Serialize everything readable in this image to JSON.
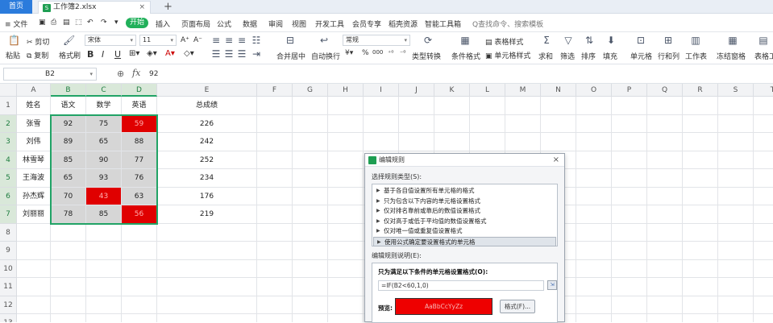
{
  "tabs": {
    "home": "首页",
    "file": "工作簿2.xlsx",
    "file_icon": "S",
    "close": "×",
    "add": "+"
  },
  "menu": {
    "file": "≡ 文件",
    "start": "开始",
    "items": [
      "插入",
      "页面布局",
      "公式",
      "数据",
      "审阅",
      "视图",
      "开发工具",
      "会员专享",
      "稻壳资源",
      "智能工具箱"
    ],
    "search": "Q查找命令、搜索模板"
  },
  "ribbon": {
    "paste": "粘贴",
    "cut": "剪切",
    "copy": "复制",
    "format_painter": "格式刷",
    "font": "宋体",
    "size": "11",
    "bold": "B",
    "italic": "I",
    "underline": "U",
    "merge": "合并居中",
    "wrap": "自动换行",
    "number_format": "常规",
    "percent": "%",
    "thousands": "000",
    "type_convert": "类型转换",
    "cond_format": "条件格式",
    "table_style": "表格样式",
    "cell_style": "单元格样式",
    "sum": "求和",
    "filter": "筛选",
    "sort": "排序",
    "fill": "填充",
    "cells": "单元格",
    "rowcol": "行和列",
    "worksheet": "工作表",
    "freeze": "冻结窗格",
    "table_tools": "表格工具"
  },
  "formula_bar": {
    "name_box": "B2",
    "fx": "fx",
    "value": "92"
  },
  "sheet": {
    "columns": [
      "A",
      "B",
      "C",
      "D",
      "E",
      "F",
      "G",
      "H",
      "I",
      "J",
      "K",
      "L",
      "M",
      "N",
      "O",
      "P",
      "Q",
      "R",
      "S",
      "T"
    ],
    "rows": [
      "1",
      "2",
      "3",
      "4",
      "5",
      "6",
      "7",
      "8",
      "9",
      "10",
      "11",
      "12",
      "13"
    ],
    "header": [
      "姓名",
      "语文",
      "数学",
      "英语",
      "总成绩"
    ],
    "data": [
      [
        "张雪",
        "92",
        "75",
        "59",
        "226"
      ],
      [
        "刘伟",
        "89",
        "65",
        "88",
        "242"
      ],
      [
        "林雪琴",
        "85",
        "90",
        "77",
        "252"
      ],
      [
        "王海波",
        "65",
        "93",
        "76",
        "234"
      ],
      [
        "孙杰辉",
        "70",
        "43",
        "63",
        "176"
      ],
      [
        "刘丽丽",
        "78",
        "85",
        "56",
        "219"
      ]
    ],
    "highlight_color": "#e00000",
    "selection_color": "#21a366"
  },
  "dialog": {
    "title": "编辑规则",
    "close": "×",
    "select_type_label": "选择规则类型(S):",
    "rule_types": [
      "基于各自值设置所有单元格的格式",
      "只为包含以下内容的单元格设置格式",
      "仅对排名靠前或靠后的数值设置格式",
      "仅对高于或低于平均值的数值设置格式",
      "仅对唯一值或重复值设置格式",
      "使用公式确定要设置格式的单元格"
    ],
    "selected_rule_index": 5,
    "desc_label": "编辑规则说明(E):",
    "desc_heading": "只为满足以下条件的单元格设置格式(O):",
    "formula": "=IF(B2<60,1,0)",
    "preview_label": "预览:",
    "preview_text": "AaBbCcYyZz",
    "format_button": "格式(F)..."
  }
}
